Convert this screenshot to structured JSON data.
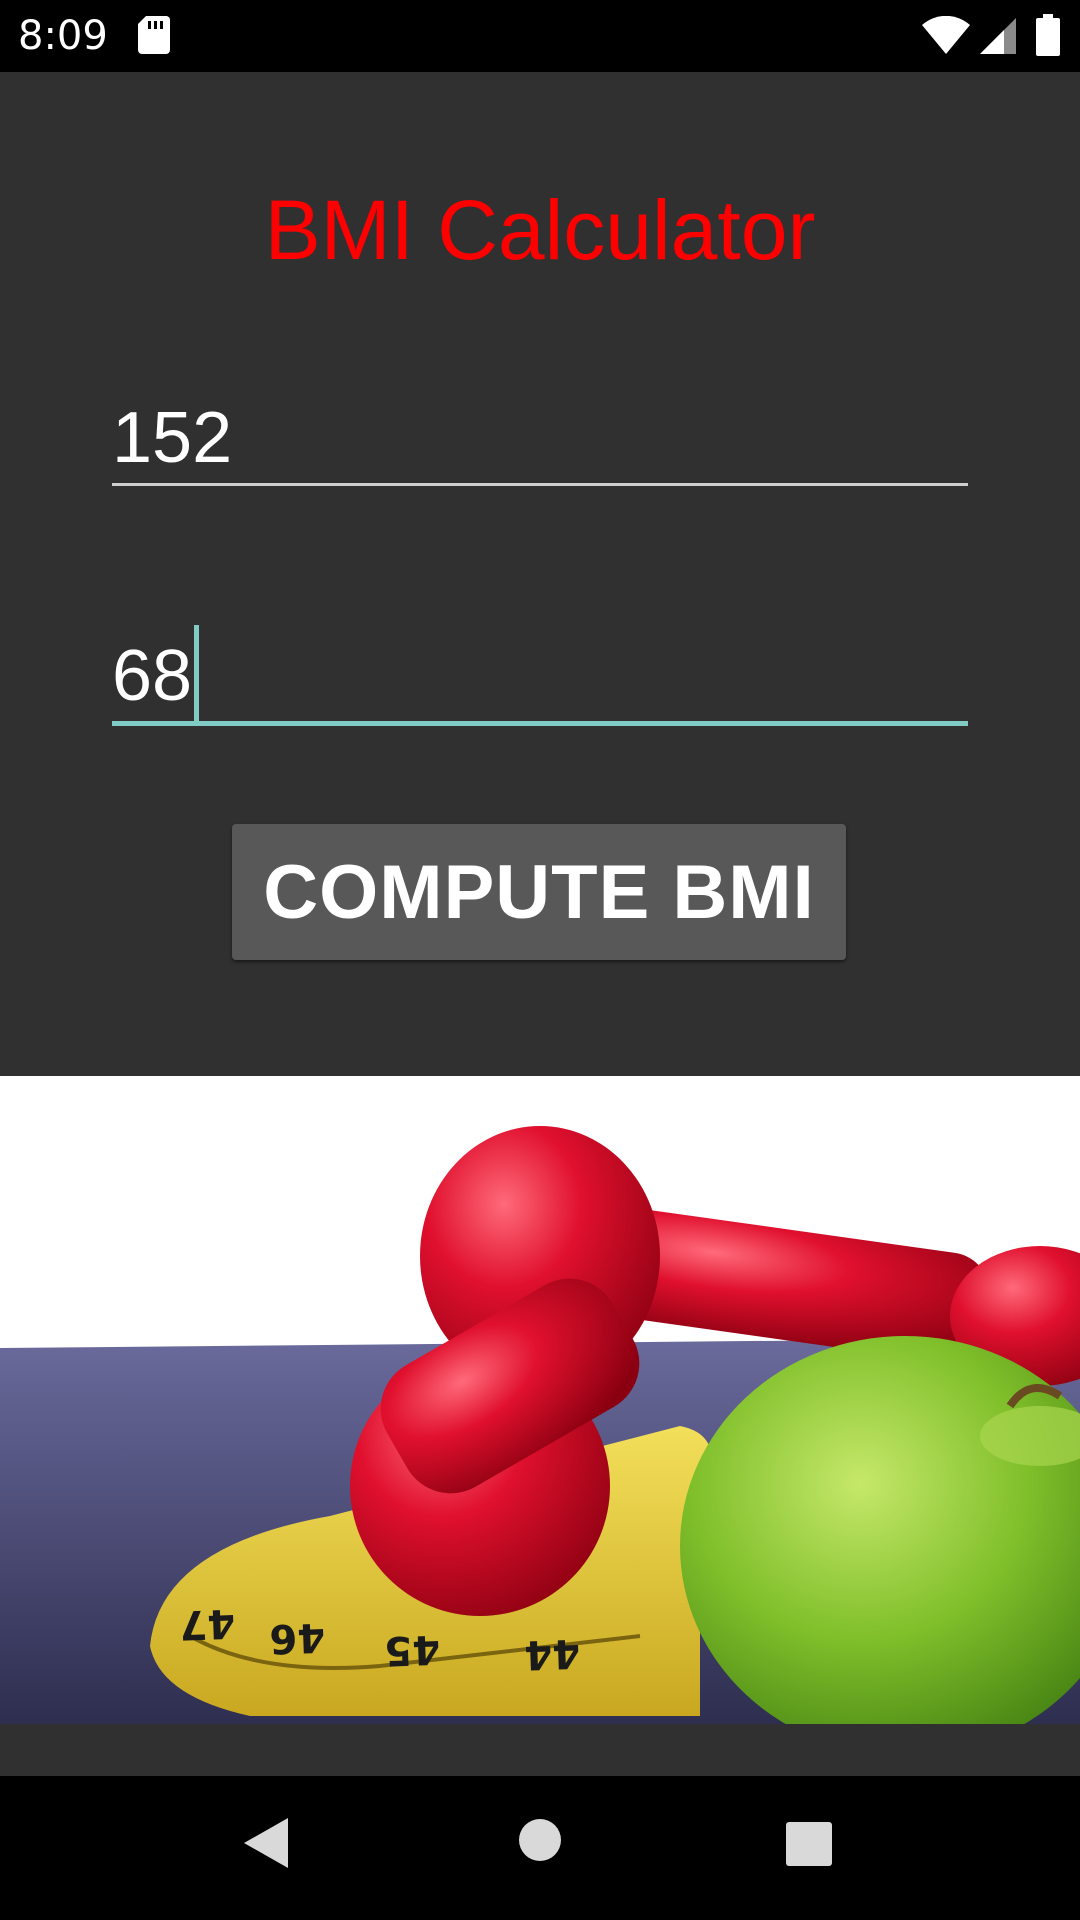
{
  "status_bar": {
    "time": "8:09",
    "icons": [
      "sd-card-icon",
      "wifi-icon",
      "signal-icon",
      "battery-icon"
    ]
  },
  "app": {
    "title": "BMI Calculator",
    "height_input": {
      "value": "152"
    },
    "weight_input": {
      "value": "68",
      "focused": true
    },
    "compute_button_label": "COMPUTE BMI",
    "illustration": "dumbbells-apple-measuring-tape-image"
  },
  "nav_bar": {
    "icons": [
      "back-icon",
      "home-icon",
      "recents-icon"
    ]
  },
  "colors": {
    "background": "#303030",
    "title": "#ff0000",
    "accent": "#80cbc4",
    "button": "#585858"
  }
}
